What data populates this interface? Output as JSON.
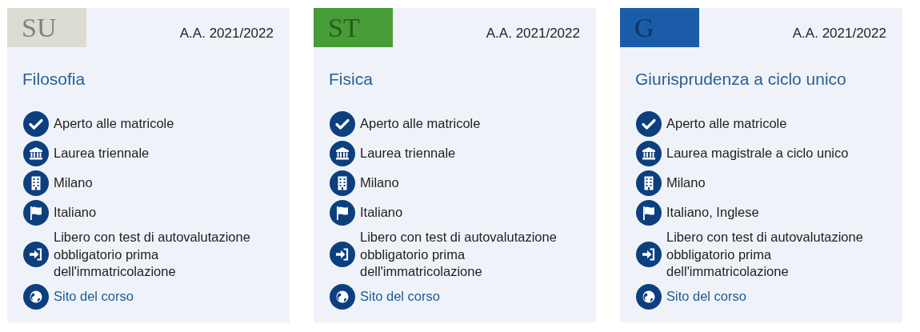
{
  "cards": [
    {
      "badge": {
        "letters": "SU",
        "color": "#dcdcd2"
      },
      "year": "A.A. 2021/2022",
      "title": "Filosofia",
      "items": [
        {
          "kind": "check",
          "text": "Aperto alle matricole"
        },
        {
          "kind": "institution",
          "text": "Laurea triennale"
        },
        {
          "kind": "building",
          "text": "Milano"
        },
        {
          "kind": "flag",
          "text": "Italiano"
        },
        {
          "kind": "enter",
          "text": "Libero con test di autovalutazione obbligatorio prima dell'immatricolazione"
        },
        {
          "kind": "globe",
          "text": "Sito del corso",
          "link": true
        }
      ]
    },
    {
      "badge": {
        "letters": "ST",
        "color": "#479c37"
      },
      "year": "A.A. 2021/2022",
      "title": "Fisica",
      "items": [
        {
          "kind": "check",
          "text": "Aperto alle matricole"
        },
        {
          "kind": "institution",
          "text": "Laurea triennale"
        },
        {
          "kind": "building",
          "text": "Milano"
        },
        {
          "kind": "flag",
          "text": "Italiano"
        },
        {
          "kind": "enter",
          "text": "Libero con test di autovalutazione obbligatorio prima dell'immatricolazione"
        },
        {
          "kind": "globe",
          "text": "Sito del corso",
          "link": true
        }
      ]
    },
    {
      "badge": {
        "letters": "G",
        "color": "#1b5ca8"
      },
      "year": "A.A. 2021/2022",
      "title": "Giurisprudenza a ciclo unico",
      "items": [
        {
          "kind": "check",
          "text": "Aperto alle matricole"
        },
        {
          "kind": "institution",
          "text": "Laurea magistrale a ciclo unico"
        },
        {
          "kind": "building",
          "text": "Milano"
        },
        {
          "kind": "flag",
          "text": "Italiano, Inglese"
        },
        {
          "kind": "enter",
          "text": "Libero con test di autovalutazione obbligatorio prima dell'immatricolazione"
        },
        {
          "kind": "globe",
          "text": "Sito del corso",
          "link": true
        }
      ]
    }
  ]
}
